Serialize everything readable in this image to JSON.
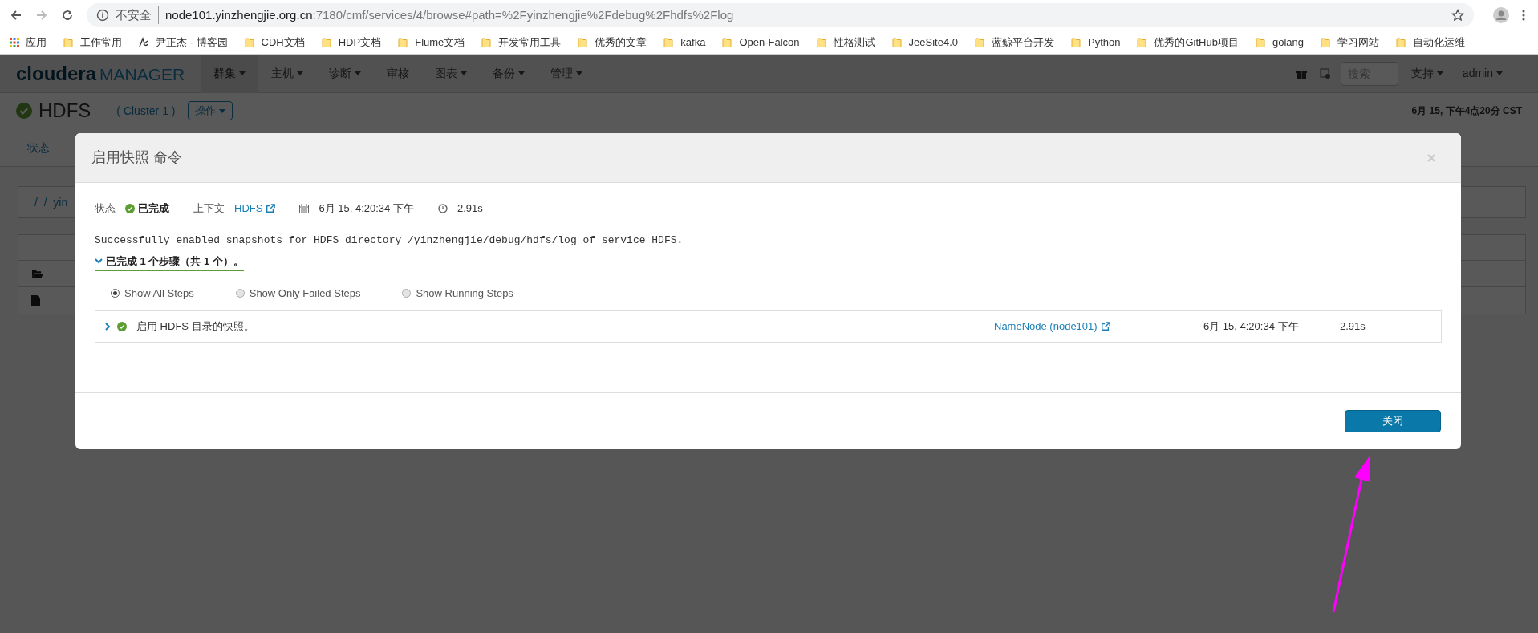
{
  "browser": {
    "security": "不安全",
    "url_host": "node101.yinzhengjie.org.cn",
    "url_rest": ":7180/cmf/services/4/browse#path=%2Fyinzhengjie%2Fdebug%2Fhdfs%2Flog",
    "bookmarks": [
      {
        "label": "应用",
        "kind": "apps"
      },
      {
        "label": "工作常用",
        "kind": "folder"
      },
      {
        "label": "尹正杰 - 博客园",
        "kind": "site"
      },
      {
        "label": "CDH文档",
        "kind": "folder"
      },
      {
        "label": "HDP文档",
        "kind": "folder"
      },
      {
        "label": "Flume文档",
        "kind": "folder"
      },
      {
        "label": "开发常用工具",
        "kind": "folder"
      },
      {
        "label": "优秀的文章",
        "kind": "folder"
      },
      {
        "label": "kafka",
        "kind": "folder"
      },
      {
        "label": "Open-Falcon",
        "kind": "folder"
      },
      {
        "label": "性格测试",
        "kind": "folder"
      },
      {
        "label": "JeeSite4.0",
        "kind": "folder"
      },
      {
        "label": "蓝鲸平台开发",
        "kind": "folder"
      },
      {
        "label": "Python",
        "kind": "folder"
      },
      {
        "label": "优秀的GitHub项目",
        "kind": "folder"
      },
      {
        "label": "golang",
        "kind": "folder"
      },
      {
        "label": "学习网站",
        "kind": "folder"
      },
      {
        "label": "自动化运维",
        "kind": "folder"
      }
    ]
  },
  "nav": {
    "logo_a": "cloudera",
    "logo_b": "MANAGER",
    "items": [
      {
        "label": "群集",
        "dropdown": true,
        "selected": true
      },
      {
        "label": "主机",
        "dropdown": true,
        "selected": false
      },
      {
        "label": "诊断",
        "dropdown": true,
        "selected": false
      },
      {
        "label": "审核",
        "dropdown": false,
        "selected": false
      },
      {
        "label": "图表",
        "dropdown": true,
        "selected": false
      },
      {
        "label": "备份",
        "dropdown": true,
        "selected": false
      },
      {
        "label": "管理",
        "dropdown": true,
        "selected": false
      }
    ],
    "search_placeholder": "搜索",
    "support": "支持",
    "user": "admin"
  },
  "service": {
    "name": "HDFS",
    "cluster": "( Cluster 1 )",
    "actions": "操作",
    "time": "6月 15, 下午4点20分 CST",
    "tab": "状态",
    "breadcrumb": "/  /  yin"
  },
  "modal": {
    "title": "启用快照 命令",
    "status_label": "状态",
    "status": "已完成",
    "context_label": "上下文",
    "context": "HDFS",
    "date": "6月 15, 4:20:34 下午",
    "duration": "2.91s",
    "message": "Successfully enabled snapshots for HDFS directory /yinzhengjie/debug/hdfs/log of service HDFS.",
    "summary": "已完成 1 个步骤（共 1 个）。",
    "expanded": true,
    "filters": [
      {
        "label": "Show All Steps",
        "selected": true
      },
      {
        "label": "Show Only Failed Steps",
        "selected": false
      },
      {
        "label": "Show Running Steps",
        "selected": false
      }
    ],
    "steps": [
      {
        "name": "启用 HDFS 目录的快照。",
        "expanded": false,
        "role": "NameNode (node101)",
        "date": "6月 15, 4:20:34 下午",
        "duration": "2.91s"
      }
    ],
    "close": "关闭"
  }
}
